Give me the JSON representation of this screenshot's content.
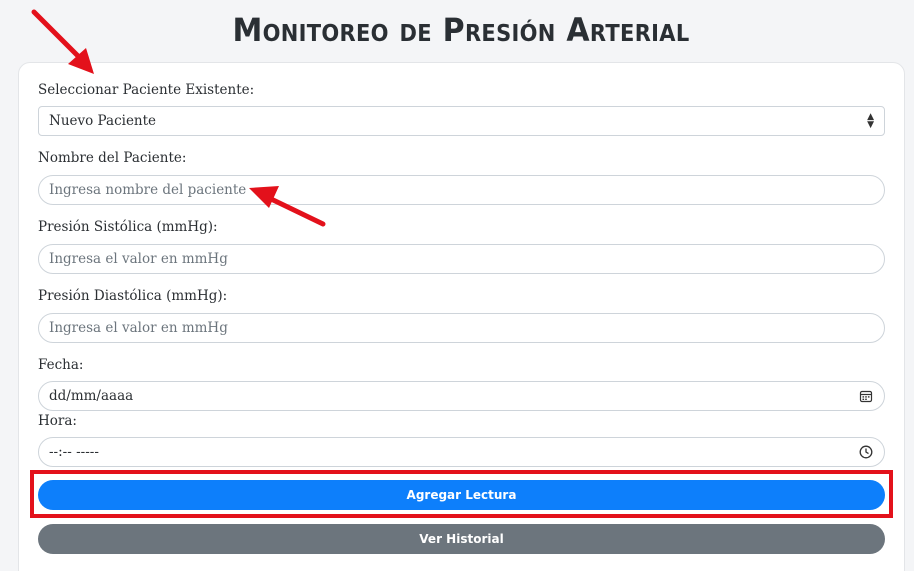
{
  "header": {
    "title": "Monitoreo de Presión Arterial"
  },
  "form": {
    "patient_select_label": "Seleccionar Paciente Existente:",
    "patient_select_value": "Nuevo Paciente",
    "name_label": "Nombre del Paciente:",
    "name_placeholder": "Ingresa nombre del paciente",
    "systolic_label": "Presión Sistólica (mmHg):",
    "systolic_placeholder": "Ingresa el valor en mmHg",
    "diastolic_label": "Presión Diastólica (mmHg):",
    "diastolic_placeholder": "Ingresa el valor en mmHg",
    "date_label": "Fecha:",
    "date_value": "dd/mm/aaaa",
    "time_label": "Hora:",
    "time_value": "--:-- -----"
  },
  "buttons": {
    "add_reading": "Agregar Lectura",
    "view_history": "Ver Historial"
  },
  "colors": {
    "primary": "#0d7ffb",
    "secondary": "#6c757d",
    "annotation": "#e3111b"
  }
}
